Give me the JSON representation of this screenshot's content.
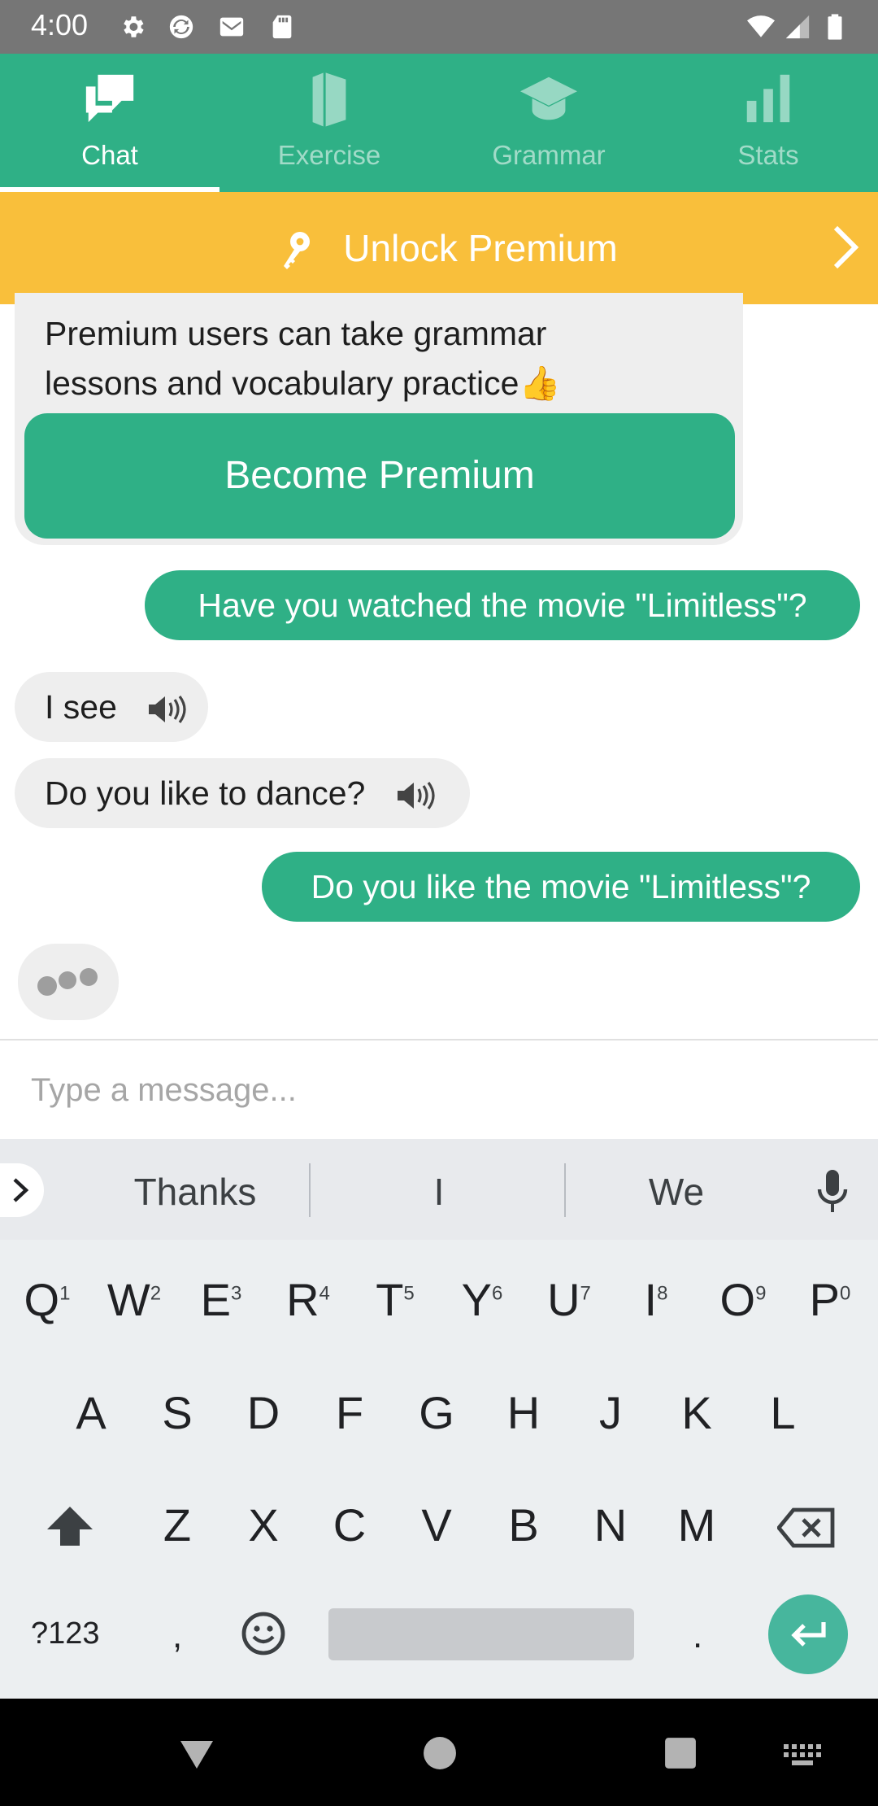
{
  "status_bar": {
    "time": "4:00"
  },
  "tabs": [
    {
      "label": "Chat",
      "icon": "chat-icon",
      "active": true
    },
    {
      "label": "Exercise",
      "icon": "book-icon",
      "active": false
    },
    {
      "label": "Grammar",
      "icon": "graduation-cap-icon",
      "active": false
    },
    {
      "label": "Stats",
      "icon": "bar-chart-icon",
      "active": false
    }
  ],
  "banner": {
    "label": "Unlock Premium",
    "icon": "key-icon"
  },
  "chat": {
    "premium_text_line1": "Premium users can take grammar",
    "premium_text_line2": "lessons and vocabulary practice",
    "premium_emoji": "👍",
    "become_premium_label": "Become Premium",
    "messages": [
      {
        "from": "user",
        "text": "Have you watched the movie \"Limitless\"?"
      },
      {
        "from": "bot",
        "text": "I see",
        "speaker": true
      },
      {
        "from": "bot",
        "text": "Do you like to dance?",
        "speaker": true
      },
      {
        "from": "user",
        "text": "Do you like the movie \"Limitless\"?"
      }
    ]
  },
  "input": {
    "placeholder": "Type a message..."
  },
  "keyboard": {
    "suggestions": [
      "Thanks",
      "I",
      "We"
    ],
    "row1": [
      "Q",
      "W",
      "E",
      "R",
      "T",
      "Y",
      "U",
      "I",
      "O",
      "P"
    ],
    "row1_sup": [
      "1",
      "2",
      "3",
      "4",
      "5",
      "6",
      "7",
      "8",
      "9",
      "0"
    ],
    "row2": [
      "A",
      "S",
      "D",
      "F",
      "G",
      "H",
      "J",
      "K",
      "L"
    ],
    "row3": [
      "Z",
      "X",
      "C",
      "V",
      "B",
      "N",
      "M"
    ],
    "symbols_label": "?123",
    "comma": ",",
    "period": "."
  },
  "colors": {
    "accent": "#2fb086",
    "banner": "#f9bf3b",
    "status_bar": "#767676"
  }
}
